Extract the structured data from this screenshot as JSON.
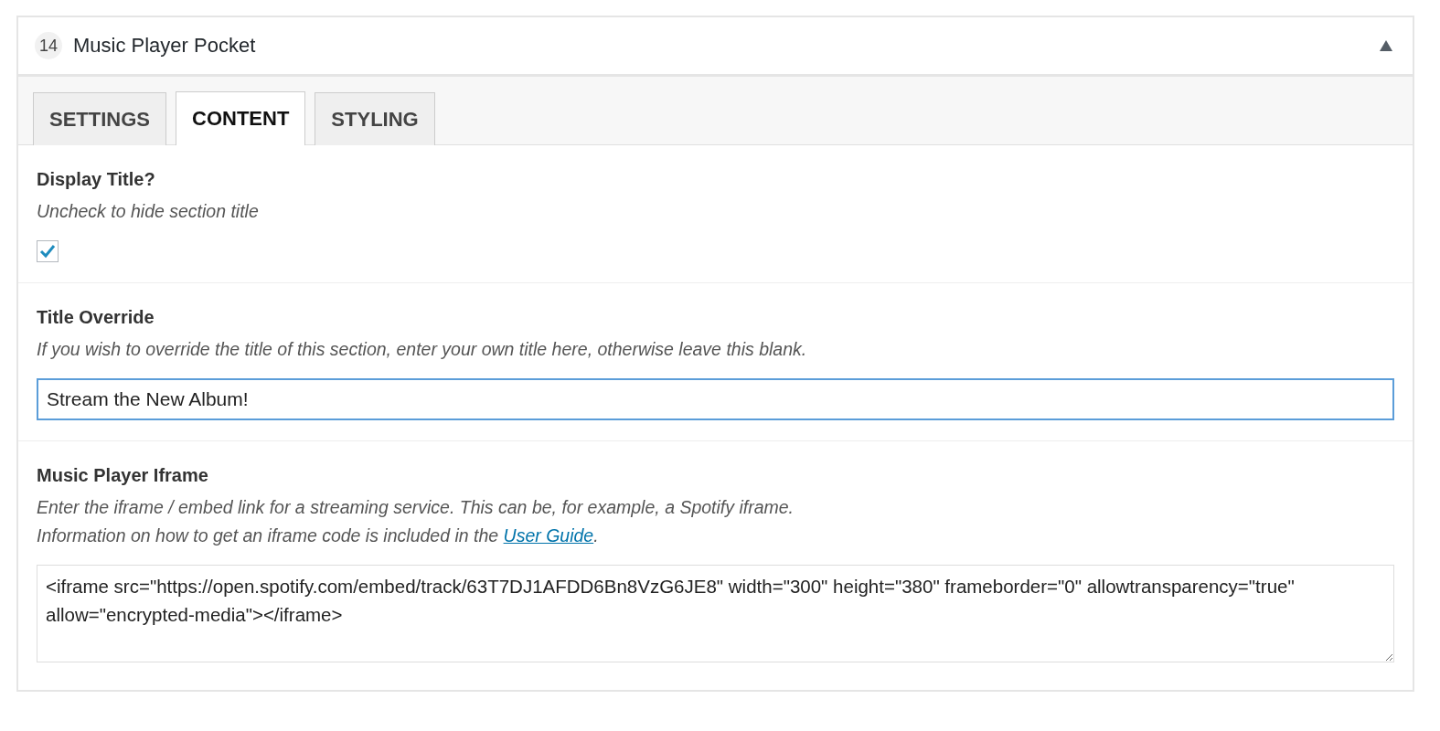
{
  "section": {
    "number": "14",
    "title": "Music Player Pocket",
    "expanded": true
  },
  "tabs": [
    {
      "label": "SETTINGS",
      "selected": false
    },
    {
      "label": "CONTENT",
      "selected": true
    },
    {
      "label": "STYLING",
      "selected": false
    }
  ],
  "display_title": {
    "label": "Display Title?",
    "description": "Uncheck to hide section title",
    "checked": true
  },
  "title_override": {
    "label": "Title Override",
    "description": "If you wish to override the title of this section, enter your own title here, otherwise leave this blank.",
    "value": "Stream the New Album!",
    "focused": true
  },
  "music_player_iframe": {
    "label": "Music Player Iframe",
    "description": "Enter the iframe / embed link for a streaming service. This can be, for example, a Spotify iframe.",
    "info_before": "Information on how to get an iframe code is included in the ",
    "info_link": "User Guide",
    "info_after": ".",
    "value": "<iframe src=\"https://open.spotify.com/embed/track/63T7DJ1AFDD6Bn8VzG6JE8\" width=\"300\" height=\"380\" frameborder=\"0\" allowtransparency=\"true\" allow=\"encrypted-media\"></iframe>"
  }
}
